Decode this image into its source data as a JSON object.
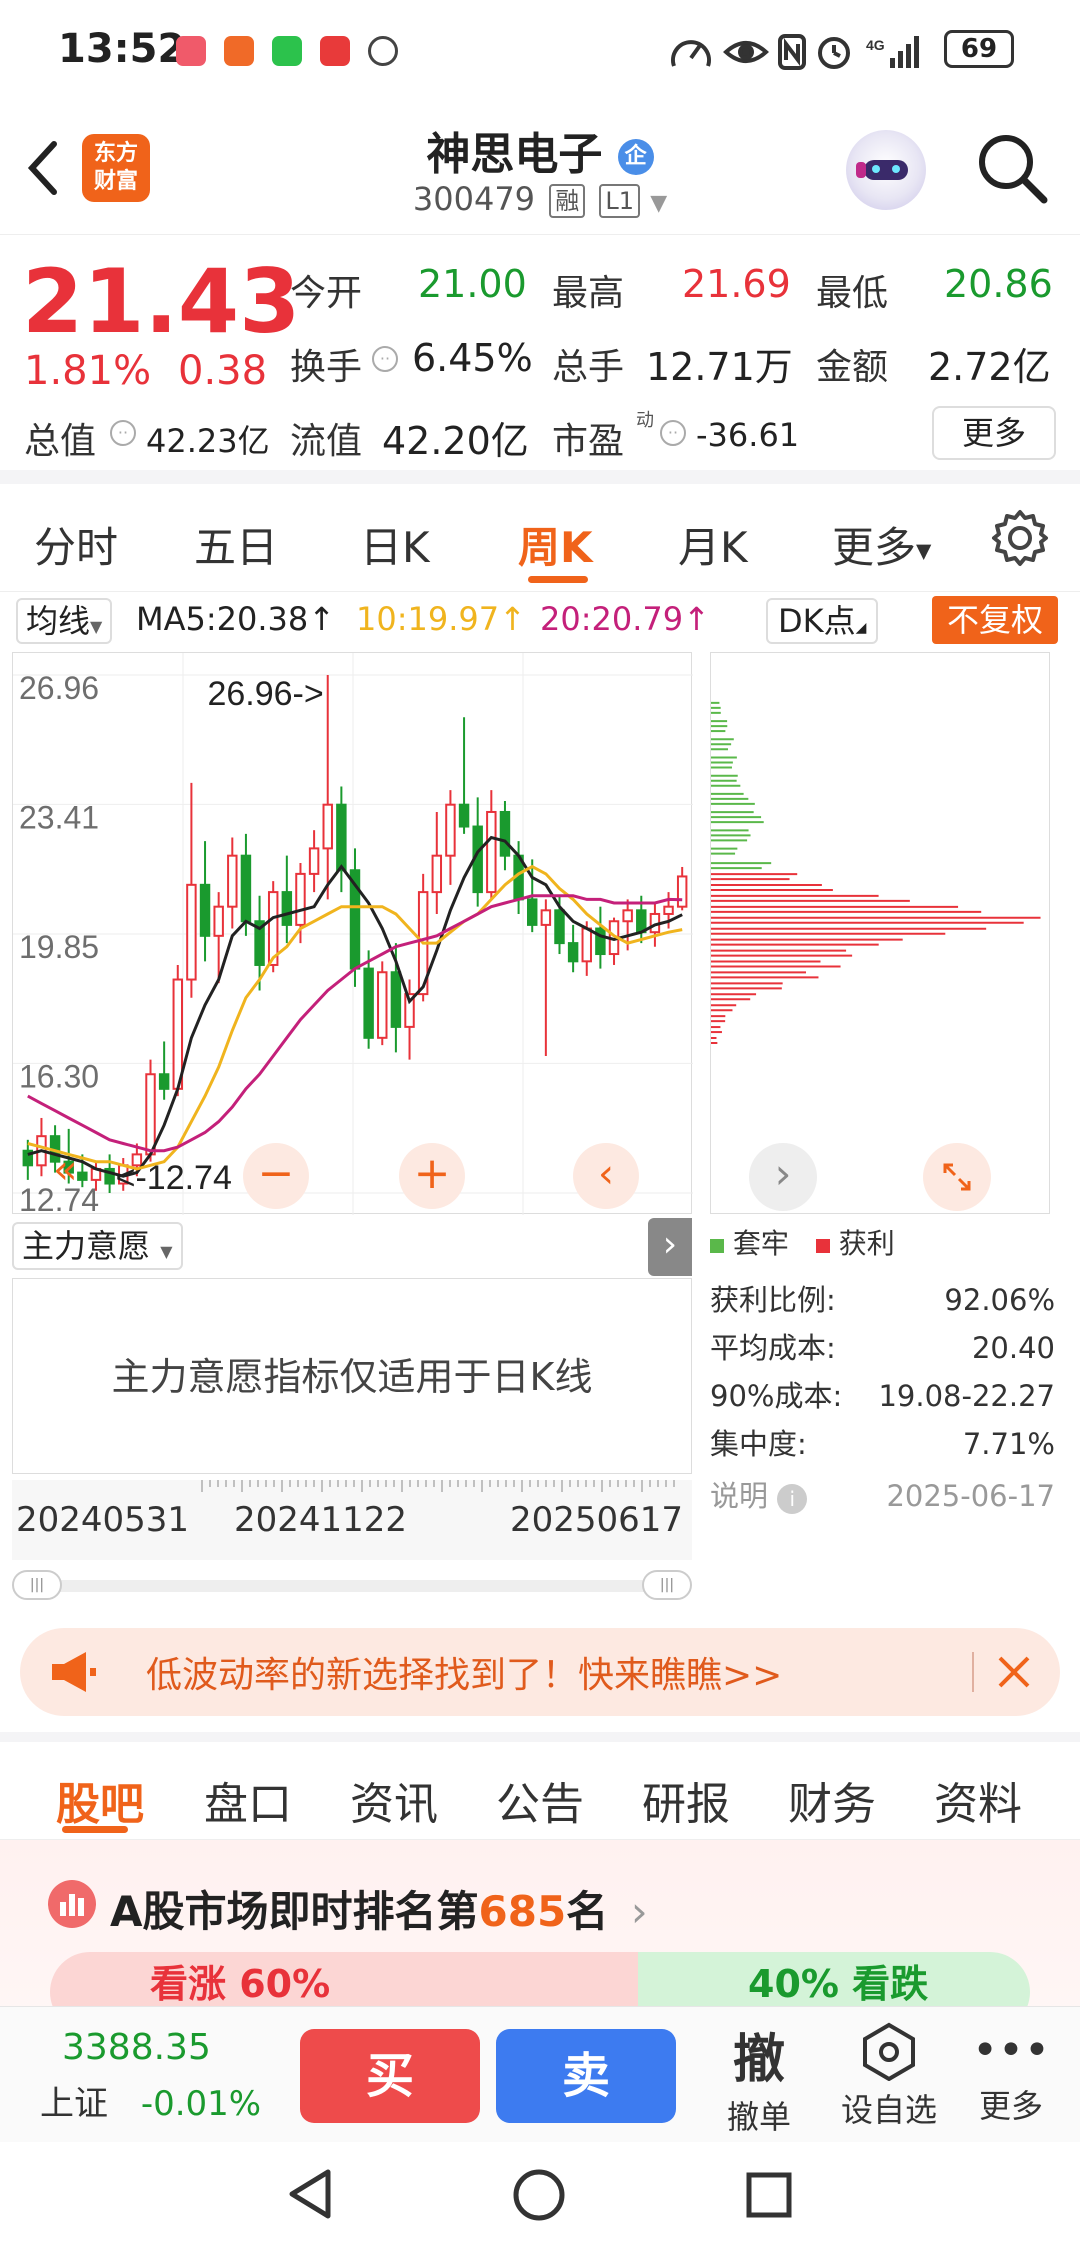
{
  "status_bar": {
    "time": "13:52",
    "network": "4G",
    "battery": "69"
  },
  "header": {
    "back_label": "<",
    "logo_text_1": "东方",
    "logo_text_2": "财富",
    "stock_name": "神思电子",
    "enterprise_badge": "企",
    "stock_code": "300479",
    "margin_tag": "融",
    "level_tag": "L1"
  },
  "quote": {
    "price": "21.43",
    "change_pct": "1.81%",
    "change_abs": "0.38",
    "open_label": "今开",
    "open_value": "21.00",
    "high_label": "最高",
    "high_value": "21.69",
    "low_label": "最低",
    "low_value": "20.86",
    "turnover_label": "换手",
    "turnover_value": "6.45%",
    "volume_label": "总手",
    "volume_value": "12.71万",
    "amount_label": "金额",
    "amount_value": "2.72亿",
    "mktcap_label": "总值",
    "mktcap_value": "42.23亿",
    "float_label": "流值",
    "float_value": "42.20亿",
    "pe_label": "市盈",
    "pe_sup": "动",
    "pe_value": "-36.61",
    "more_button": "更多"
  },
  "period_tabs": [
    "分时",
    "五日",
    "日K",
    "周K",
    "月K",
    "更多"
  ],
  "chart_toolbar": {
    "ma_selector": "均线",
    "ma5": "MA5:20.38↑",
    "ma10": "10:19.97↑",
    "ma20": "20:20.79↑",
    "dk_selector": "DK点",
    "adjust_button": "不复权"
  },
  "chart_data": {
    "type": "candlestick",
    "title": "",
    "y_ticks": [
      "26.96",
      "23.41",
      "19.85",
      "16.30",
      "12.74"
    ],
    "ylim": [
      12.74,
      26.96
    ],
    "max_annotation": "26.96->",
    "min_annotation": "<-12.74",
    "x_ticks": [
      "20240531",
      "20241122",
      "20250617"
    ],
    "candles": [
      [
        13.9,
        14.2,
        13.1,
        13.5
      ],
      [
        13.5,
        14.8,
        13.2,
        14.3
      ],
      [
        14.3,
        14.6,
        13.3,
        13.6
      ],
      [
        13.6,
        14.5,
        13.0,
        13.3
      ],
      [
        13.3,
        13.8,
        12.9,
        13.1
      ],
      [
        13.1,
        13.6,
        12.8,
        13.4
      ],
      [
        13.4,
        13.8,
        12.74,
        13.0
      ],
      [
        13.0,
        13.7,
        12.8,
        13.5
      ],
      [
        13.5,
        14.1,
        13.2,
        13.8
      ],
      [
        13.8,
        16.4,
        13.6,
        16.0
      ],
      [
        16.0,
        16.9,
        15.3,
        15.6
      ],
      [
        15.6,
        19.0,
        15.4,
        18.6
      ],
      [
        18.6,
        24.0,
        18.1,
        21.2
      ],
      [
        21.2,
        22.4,
        19.1,
        19.8
      ],
      [
        19.8,
        21.0,
        18.5,
        20.6
      ],
      [
        20.6,
        22.5,
        20.0,
        22.0
      ],
      [
        22.0,
        22.6,
        19.8,
        20.2
      ],
      [
        20.2,
        20.9,
        18.3,
        19.0
      ],
      [
        19.0,
        21.3,
        18.8,
        21.0
      ],
      [
        21.0,
        22.0,
        19.6,
        20.1
      ],
      [
        20.1,
        21.8,
        19.6,
        21.5
      ],
      [
        21.5,
        22.7,
        21.0,
        22.2
      ],
      [
        22.2,
        26.96,
        20.8,
        23.4
      ],
      [
        23.4,
        23.9,
        21.0,
        21.6
      ],
      [
        21.6,
        22.2,
        18.4,
        18.9
      ],
      [
        18.9,
        19.4,
        16.7,
        17.0
      ],
      [
        17.0,
        19.1,
        16.8,
        18.8
      ],
      [
        18.8,
        19.6,
        16.6,
        17.3
      ],
      [
        17.3,
        18.6,
        16.4,
        18.2
      ],
      [
        18.2,
        21.5,
        18.0,
        21.0
      ],
      [
        21.0,
        23.2,
        20.4,
        22.0
      ],
      [
        22.0,
        23.8,
        21.2,
        23.4
      ],
      [
        23.4,
        25.8,
        22.6,
        22.8
      ],
      [
        22.8,
        23.6,
        20.6,
        21.0
      ],
      [
        21.0,
        23.8,
        20.8,
        23.2
      ],
      [
        23.2,
        23.5,
        21.6,
        22.0
      ],
      [
        22.0,
        22.4,
        20.4,
        20.8
      ],
      [
        20.8,
        21.9,
        19.9,
        20.1
      ],
      [
        20.1,
        20.8,
        16.5,
        20.5
      ],
      [
        20.5,
        20.9,
        19.3,
        19.6
      ],
      [
        19.6,
        20.1,
        18.8,
        19.1
      ],
      [
        19.1,
        20.2,
        18.7,
        20.0
      ],
      [
        20.0,
        20.6,
        18.9,
        19.3
      ],
      [
        19.3,
        20.3,
        19.0,
        20.2
      ],
      [
        20.2,
        20.8,
        19.4,
        20.5
      ],
      [
        20.5,
        20.9,
        19.6,
        19.9
      ],
      [
        19.9,
        20.7,
        19.5,
        20.4
      ],
      [
        20.4,
        21.0,
        20.0,
        20.6
      ],
      [
        20.6,
        21.69,
        20.5,
        21.43
      ]
    ],
    "ma5": [
      13.8,
      13.9,
      13.8,
      13.7,
      13.6,
      13.4,
      13.3,
      13.2,
      13.3,
      13.8,
      14.6,
      15.6,
      17.0,
      17.9,
      18.6,
      19.8,
      20.2,
      20.0,
      20.3,
      20.4,
      20.5,
      20.6,
      21.2,
      21.7,
      21.2,
      20.7,
      20.0,
      19.1,
      18.0,
      18.4,
      19.4,
      20.5,
      21.4,
      22.1,
      22.5,
      22.4,
      22.0,
      21.4,
      21.2,
      20.6,
      20.2,
      20.0,
      19.8,
      19.7,
      19.8,
      19.9,
      20.1,
      20.2,
      20.38
    ],
    "ma10": [
      14.1,
      14.0,
      13.9,
      13.8,
      13.7,
      13.6,
      13.6,
      13.5,
      13.4,
      13.5,
      13.6,
      14.0,
      14.7,
      15.4,
      16.2,
      17.2,
      18.1,
      18.6,
      19.2,
      19.5,
      20.0,
      20.2,
      20.4,
      20.6,
      20.6,
      20.6,
      20.6,
      20.4,
      20.0,
      19.6,
      19.6,
      19.9,
      20.2,
      20.4,
      20.8,
      21.2,
      21.5,
      21.7,
      21.5,
      21.1,
      20.8,
      20.4,
      20.1,
      19.8,
      19.6,
      19.7,
      19.8,
      19.9,
      19.97
    ],
    "ma20": [
      15.4,
      15.2,
      15.0,
      14.8,
      14.6,
      14.4,
      14.2,
      14.1,
      14.0,
      13.9,
      13.9,
      14.0,
      14.2,
      14.4,
      14.7,
      15.1,
      15.6,
      16.0,
      16.5,
      17.0,
      17.5,
      17.9,
      18.3,
      18.6,
      18.9,
      19.1,
      19.3,
      19.5,
      19.6,
      19.7,
      19.8,
      20.0,
      20.2,
      20.4,
      20.6,
      20.7,
      20.8,
      20.9,
      20.9,
      20.9,
      20.9,
      20.8,
      20.8,
      20.7,
      20.7,
      20.7,
      20.7,
      20.8,
      20.79
    ],
    "chip_distribution": {
      "price_bins": [
        26.0,
        25.5,
        25.0,
        24.5,
        24.0,
        23.5,
        23.0,
        22.5,
        22.0,
        21.7,
        21.4,
        21.1,
        20.8,
        20.5,
        20.2,
        19.9,
        19.6,
        19.3,
        19.0,
        18.7,
        18.4,
        18.1,
        17.8,
        17.5,
        17.2,
        16.9
      ],
      "weights": [
        0.03,
        0.05,
        0.07,
        0.09,
        0.11,
        0.14,
        0.16,
        0.12,
        0.08,
        0.2,
        0.34,
        0.48,
        0.66,
        0.82,
        1.0,
        0.88,
        0.72,
        0.58,
        0.45,
        0.33,
        0.22,
        0.14,
        0.09,
        0.06,
        0.04,
        0.02
      ],
      "current_price": 21.43
    }
  },
  "chip_legend": {
    "trapped": "套牢",
    "profit": "获利"
  },
  "indicator": {
    "selector": "主力意愿",
    "notice": "主力意愿指标仅适用于日K线"
  },
  "chip_stats": {
    "profit_ratio_label": "获利比例:",
    "profit_ratio": "92.06%",
    "avg_cost_label": "平均成本:",
    "avg_cost": "20.40",
    "cost90_label": "90%成本:",
    "cost90": "19.08-22.27",
    "concentration_label": "集中度:",
    "concentration": "7.71%",
    "note_label": "说明",
    "date": "2025-06-17"
  },
  "promo": {
    "text": "低波动率的新选择找到了！快来瞧瞧>>"
  },
  "sub_tabs": [
    "股吧",
    "盘口",
    "资讯",
    "公告",
    "研报",
    "财务",
    "资料"
  ],
  "ranking": {
    "prefix": "A股市场即时排名第",
    "rank": "685",
    "suffix": "名",
    "bull_text": "看涨 60%",
    "bear_text": "40% 看跌"
  },
  "bottom_bar": {
    "index_value": "3388.35",
    "index_name": "上证",
    "index_change": "-0.01%",
    "buy": "买",
    "sell": "卖",
    "cancel_icon": "撤",
    "cancel_label": "撤单",
    "watchlist_label": "设自选",
    "more_label": "更多"
  },
  "colors": {
    "up": "#e8323a",
    "down": "#1a9a2e",
    "accent": "#f0631a",
    "ma5": "#222222",
    "ma10": "#f0b41e",
    "ma20": "#c4207a",
    "sell_blue": "#3d7bf0"
  }
}
